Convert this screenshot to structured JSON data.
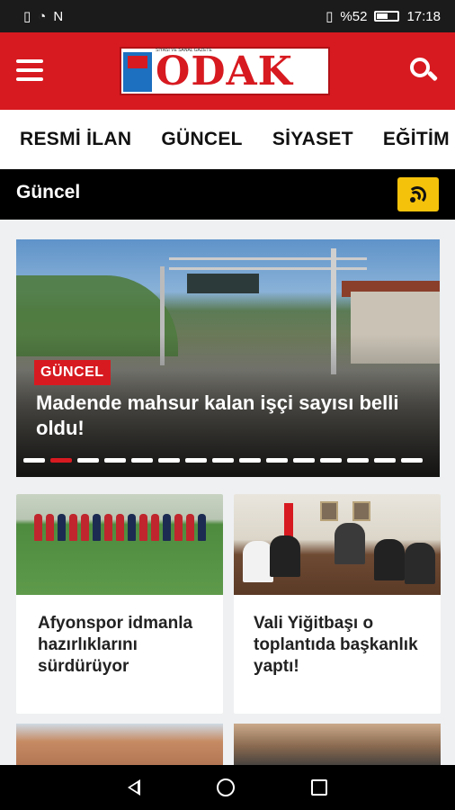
{
  "status_bar": {
    "left_icons": [
      "sim-card-icon",
      "wifi-icon",
      "nfc-icon"
    ],
    "vibrate_icon": "vibrate-icon",
    "battery_percent": "%52",
    "battery_level": 0.52,
    "time": "17:18"
  },
  "header": {
    "menu_icon": "hamburger-menu-icon",
    "logo_text": "ODAK",
    "logo_tagline": "SİYASİ VE SANAL GAZETE",
    "search_icon": "search-icon",
    "brand_color": "#d71a20"
  },
  "categories": [
    {
      "label": "RESMİ İLAN"
    },
    {
      "label": "GÜNCEL"
    },
    {
      "label": "SİYASET"
    },
    {
      "label": "EĞİTİM"
    }
  ],
  "section": {
    "title": "Güncel",
    "rss_icon": "rss-icon",
    "rss_color": "#f5c20b"
  },
  "hero": {
    "category_badge": "GÜNCEL",
    "title": "Madende mahsur kalan işçi sayısı belli oldu!",
    "slide_count": 15,
    "active_slide": 2
  },
  "cards": [
    {
      "title": "Afyonspor idmanla hazırlıklarını sürdürüyor"
    },
    {
      "title": "Vali Yiğitbaşı o toplantıda başkanlık yaptı!"
    }
  ],
  "nav_bar": {
    "back_icon": "back-triangle-icon",
    "home_icon": "home-circle-icon",
    "recents_icon": "recents-square-icon"
  }
}
